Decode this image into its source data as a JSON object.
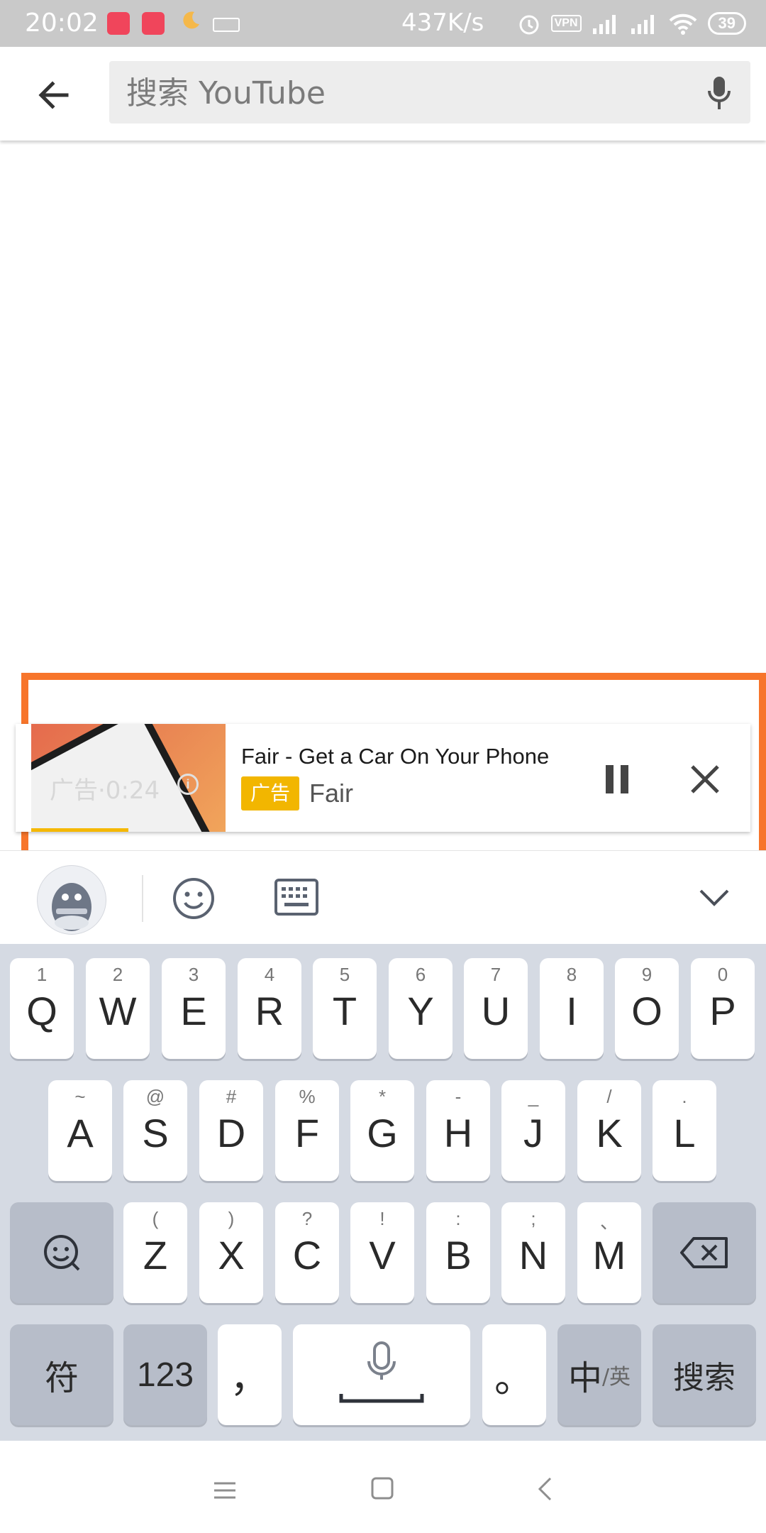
{
  "status_bar": {
    "time": "20:02",
    "net_speed": "437K/s",
    "vpn_label": "VPN",
    "battery": "39"
  },
  "header": {
    "search_placeholder": "搜索 YouTube"
  },
  "ad": {
    "thumb_overlay": "广告·0:24",
    "title": "Fair - Get a Car On Your Phone",
    "badge": "广告",
    "advertiser": "Fair"
  },
  "keyboard": {
    "row1": [
      {
        "hint": "1",
        "key": "Q"
      },
      {
        "hint": "2",
        "key": "W"
      },
      {
        "hint": "3",
        "key": "E"
      },
      {
        "hint": "4",
        "key": "R"
      },
      {
        "hint": "5",
        "key": "T"
      },
      {
        "hint": "6",
        "key": "Y"
      },
      {
        "hint": "7",
        "key": "U"
      },
      {
        "hint": "8",
        "key": "I"
      },
      {
        "hint": "9",
        "key": "O"
      },
      {
        "hint": "0",
        "key": "P"
      }
    ],
    "row2": [
      {
        "hint": "~",
        "key": "A"
      },
      {
        "hint": "@",
        "key": "S"
      },
      {
        "hint": "#",
        "key": "D"
      },
      {
        "hint": "%",
        "key": "F"
      },
      {
        "hint": "*",
        "key": "G"
      },
      {
        "hint": "-",
        "key": "H"
      },
      {
        "hint": "_",
        "key": "J"
      },
      {
        "hint": "/",
        "key": "K"
      },
      {
        "hint": ".",
        "key": "L"
      }
    ],
    "row3": [
      {
        "hint": "(",
        "key": "Z"
      },
      {
        "hint": ")",
        "key": "X"
      },
      {
        "hint": "?",
        "key": "C"
      },
      {
        "hint": "!",
        "key": "V"
      },
      {
        "hint": ":",
        "key": "B"
      },
      {
        "hint": ";",
        "key": "N"
      },
      {
        "hint": "、",
        "key": "M"
      }
    ],
    "symbol_key": "符",
    "number_key": "123",
    "comma_key": "，",
    "period_key": "。",
    "lang_key_main": "中",
    "lang_key_sub": "/英",
    "search_key": "搜索"
  }
}
